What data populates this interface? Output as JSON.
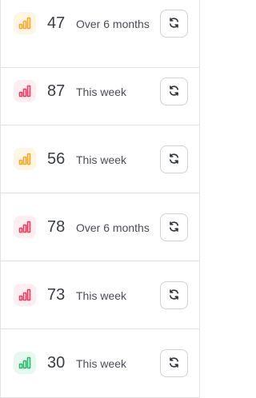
{
  "colors": {
    "orange": "#f5a623",
    "orange_bg": "#fff5e3",
    "red": "#f0365a",
    "red_bg": "#ffeef1",
    "green": "#22b86a",
    "green_bg": "#e7f8ee"
  },
  "rows": [
    {
      "score": "47",
      "period": "Over 6 months",
      "level": "orange",
      "icon": "signal-bars-icon"
    },
    {
      "score": "87",
      "period": "This week",
      "level": "red",
      "icon": "signal-bars-icon"
    },
    {
      "score": "56",
      "period": "This week",
      "level": "orange",
      "icon": "signal-bars-icon"
    },
    {
      "score": "78",
      "period": "Over 6 months",
      "level": "red",
      "icon": "signal-bars-icon"
    },
    {
      "score": "73",
      "period": "This week",
      "level": "red",
      "icon": "signal-bars-icon"
    },
    {
      "score": "30",
      "period": "This week",
      "level": "green",
      "icon": "signal-bars-icon"
    }
  ],
  "refresh_icon": "refresh-icon"
}
